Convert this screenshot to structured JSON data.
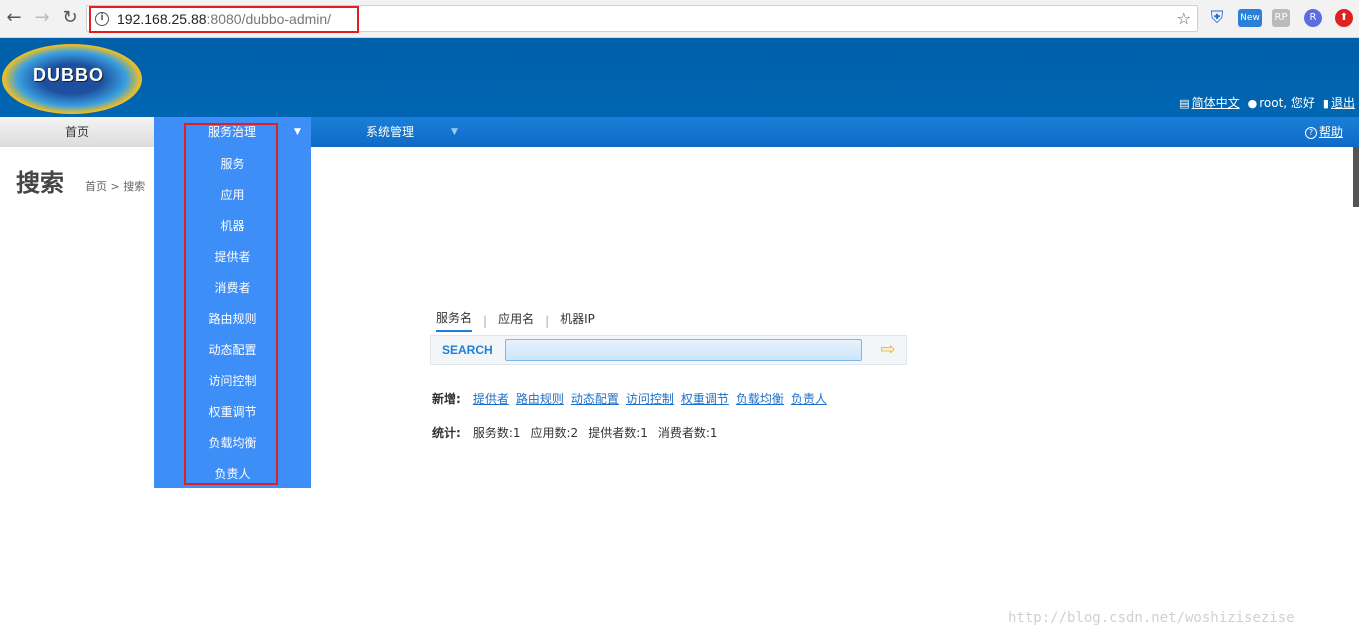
{
  "browser": {
    "url_host": "192.168.25.88",
    "url_rest": ":8080/dubbo-admin/"
  },
  "header": {
    "logo_text": "DUBBO",
    "lang_link": "简体中文",
    "greeting": "root, 您好",
    "logout": "退出"
  },
  "nav": {
    "home": "首页",
    "service_governance": "服务治理",
    "system_management": "系统管理",
    "help": "帮助"
  },
  "dropdown": {
    "items": [
      "服务",
      "应用",
      "机器",
      "提供者",
      "消费者",
      "路由规则",
      "动态配置",
      "访问控制",
      "权重调节",
      "负载均衡",
      "负责人"
    ]
  },
  "page": {
    "title": "搜索",
    "breadcrumb": "首页 > 搜索"
  },
  "search": {
    "tabs": [
      "服务名",
      "应用名",
      "机器IP"
    ],
    "label": "SEARCH",
    "value": ""
  },
  "add": {
    "head": "新增:",
    "links": [
      "提供者",
      "路由规则",
      "动态配置",
      "访问控制",
      "权重调节",
      "负载均衡",
      "负责人"
    ]
  },
  "stats": {
    "head": "统计:",
    "items": [
      "服务数:1",
      "应用数:2",
      "提供者数:1",
      "消费者数:1"
    ]
  },
  "watermark": "http://blog.csdn.net/woshizisezise"
}
